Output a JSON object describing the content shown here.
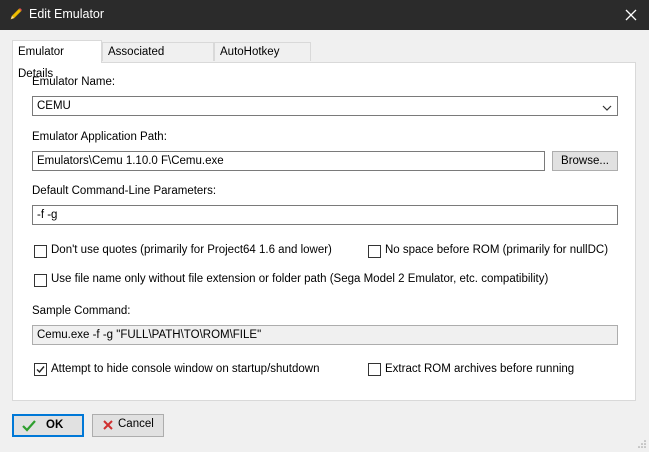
{
  "window": {
    "title": "Edit Emulator",
    "icon": "pencil-icon"
  },
  "tabs": [
    {
      "label": "Emulator Details",
      "active": true
    },
    {
      "label": "Associated Platforms",
      "active": false
    },
    {
      "label": "AutoHotkey Script",
      "active": false
    }
  ],
  "form": {
    "emulator_name_label": "Emulator Name:",
    "emulator_name_value": "CEMU",
    "app_path_label": "Emulator Application Path:",
    "app_path_value": "Emulators\\Cemu 1.10.0 F\\Cemu.exe",
    "browse_label": "Browse...",
    "params_label": "Default Command-Line Parameters:",
    "params_value": "-f -g",
    "opt_no_quotes": {
      "label": "Don't use quotes (primarily for Project64 1.6 and lower)",
      "checked": false
    },
    "opt_no_space": {
      "label": "No space before ROM (primarily for nullDC)",
      "checked": false
    },
    "opt_file_name_only": {
      "label": "Use file name only without file extension or folder path (Sega Model 2 Emulator, etc. compatibility)",
      "checked": false
    },
    "sample_label": "Sample Command:",
    "sample_value": "Cemu.exe -f -g \"FULL\\PATH\\TO\\ROM\\FILE\"",
    "opt_hide_console": {
      "label": "Attempt to hide console window on startup/shutdown",
      "checked": true
    },
    "opt_extract_rom": {
      "label": "Extract ROM archives before running",
      "checked": false
    }
  },
  "footer": {
    "ok_label": "OK",
    "cancel_label": "Cancel"
  },
  "colors": {
    "titlebar": "#2b2b2b",
    "focus_border": "#0078d7",
    "ok_check": "#2e9e2e",
    "cancel_x": "#d03030"
  }
}
